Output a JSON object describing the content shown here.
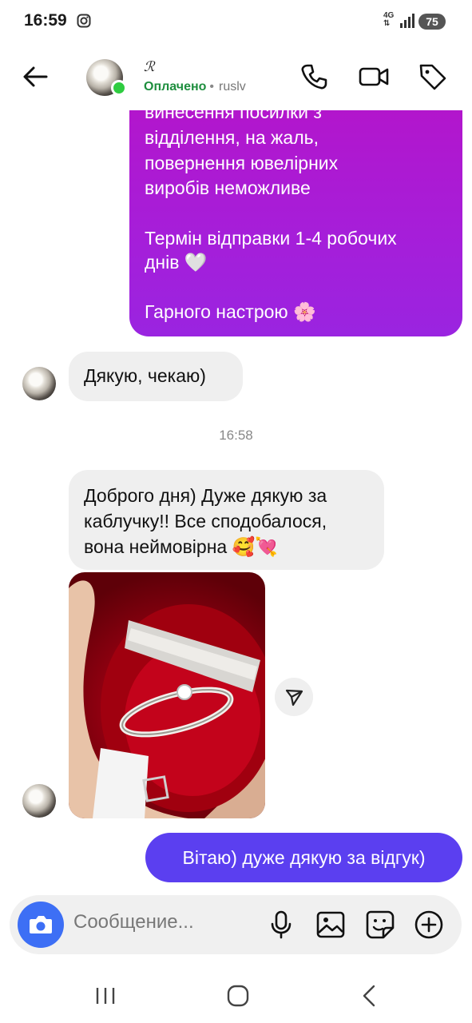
{
  "status_bar": {
    "time": "16:59",
    "network": "4G",
    "battery": "75"
  },
  "header": {
    "contact_name": "ℛ",
    "status": "Оплачено",
    "username": "ruslv"
  },
  "messages": {
    "outgoing_1_lines": [
      "винесення посилки з",
      "відділення, на жаль,",
      "повернення ювелірних",
      "виробів неможливе",
      "",
      "Термін відправки 1-4 робочих",
      "днів 🤍",
      "",
      "Гарного настрою 🌸"
    ],
    "incoming_1": "Дякую, чекаю)",
    "timestamp": "16:58",
    "incoming_2_lines": [
      "Доброго дня) Дуже дякую за",
      "каблучку!! Все сподобалося,",
      "вона неймовірна 🥰💘"
    ],
    "outgoing_2": "Вітаю) дуже дякую за відгук)"
  },
  "composer": {
    "placeholder": "Сообщение..."
  },
  "colors": {
    "bubble_purple": "#a61ed9",
    "bubble_blue": "#5b3ff0",
    "incoming_bg": "#efefef",
    "online": "#2ecc40",
    "paid_green": "#1e8e3e",
    "camera_blue": "#3d6ff5"
  },
  "icons": {
    "back": "arrow-left-icon",
    "call": "phone-icon",
    "video": "video-camera-icon",
    "tag": "tag-icon",
    "share": "send-icon",
    "camera": "camera-icon",
    "mic": "microphone-icon",
    "gallery": "image-icon",
    "sticker": "sticker-icon",
    "more": "plus-circle-icon"
  }
}
